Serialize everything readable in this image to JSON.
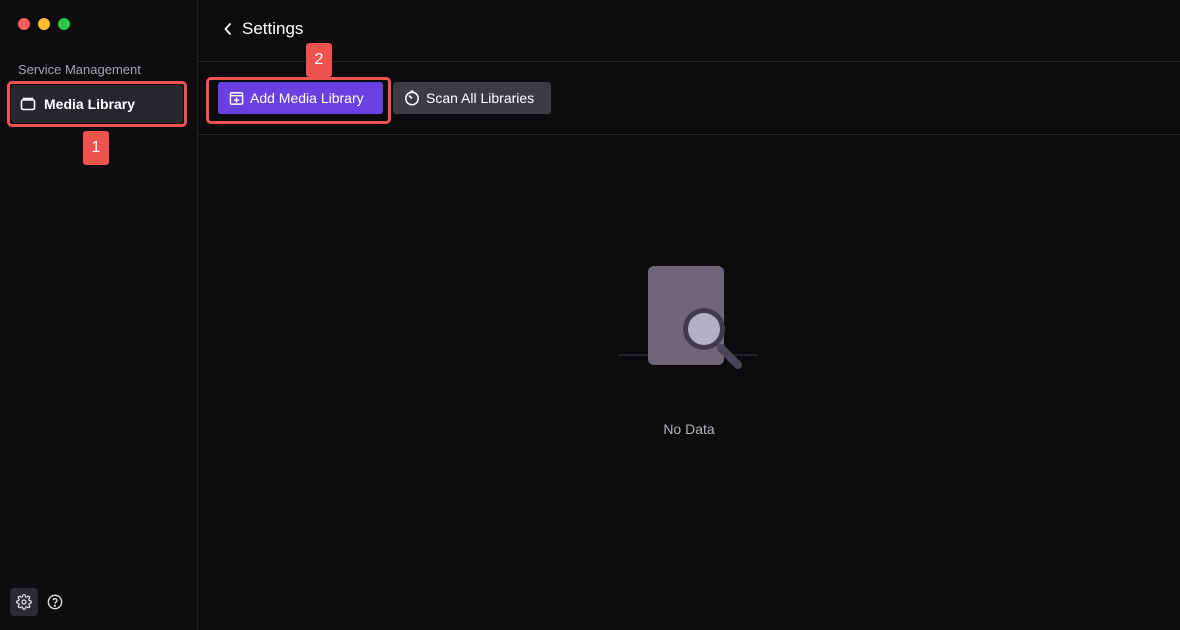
{
  "window": {
    "traffic_lights": [
      "#ff5f57",
      "#febc2e",
      "#28c840"
    ]
  },
  "sidebar": {
    "section_label": "Service Management",
    "items": [
      {
        "label": "Media Library",
        "icon": "folder-icon",
        "active": true
      }
    ],
    "bottom": [
      {
        "icon": "gear-icon",
        "active": true
      },
      {
        "icon": "help-icon",
        "active": false
      }
    ]
  },
  "header": {
    "back_icon": "chevron-left-icon",
    "title": "Settings"
  },
  "toolbar": {
    "add_label": "Add Media Library",
    "add_icon": "add-box-icon",
    "scan_label": "Scan All Libraries",
    "scan_icon": "scan-timer-icon"
  },
  "empty_state": {
    "icon": "document-search-icon",
    "text": "No Data"
  },
  "annotations": [
    {
      "label": "1"
    },
    {
      "label": "2"
    }
  ],
  "colors": {
    "accent": "#6841e0",
    "highlight": "#ef5350",
    "secondary_button": "#3c3c41"
  }
}
